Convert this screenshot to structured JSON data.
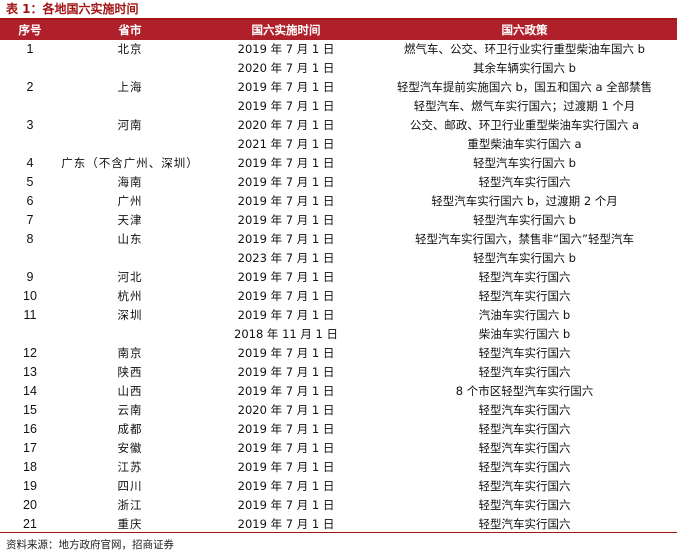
{
  "title": "表 1：各地国六实施时间",
  "headers": [
    "序号",
    "省市",
    "国六实施时间",
    "国六政策"
  ],
  "rows": [
    {
      "no": "1",
      "region": "北京",
      "date": "2019 年 7 月 1 日",
      "policy": "燃气车、公交、环卫行业实行重型柴油车国六 b"
    },
    {
      "no": "",
      "region": "",
      "date": "2020 年 7 月 1 日",
      "policy": "其余车辆实行国六 b"
    },
    {
      "no": "2",
      "region": "上海",
      "date": "2019 年 7 月 1 日",
      "policy": "轻型汽车提前实施国六 b，国五和国六 a 全部禁售"
    },
    {
      "no": "",
      "region": "",
      "date": "2019 年 7 月 1 日",
      "policy": "轻型汽车、燃气车实行国六；过渡期 1 个月"
    },
    {
      "no": "3",
      "region": "河南",
      "date": "2020 年 7 月 1 日",
      "policy": "公交、邮政、环卫行业重型柴油车实行国六 a"
    },
    {
      "no": "",
      "region": "",
      "date": "2021 年 7 月 1 日",
      "policy": "重型柴油车实行国六 a"
    },
    {
      "no": "4",
      "region": "广东（不含广州、深圳）",
      "date": "2019 年 7 月 1 日",
      "policy": "轻型汽车实行国六 b"
    },
    {
      "no": "5",
      "region": "海南",
      "date": "2019 年 7 月 1 日",
      "policy": "轻型汽车实行国六"
    },
    {
      "no": "6",
      "region": "广州",
      "date": "2019 年 7 月 1 日",
      "policy": "轻型汽车实行国六 b，过渡期 2 个月"
    },
    {
      "no": "7",
      "region": "天津",
      "date": "2019 年 7 月 1 日",
      "policy": "轻型汽车实行国六 b"
    },
    {
      "no": "8",
      "region": "山东",
      "date": "2019 年 7 月 1 日",
      "policy": "轻型汽车实行国六，禁售非“国六”轻型汽车"
    },
    {
      "no": "",
      "region": "",
      "date": "2023 年 7 月 1 日",
      "policy": "轻型汽车实行国六 b"
    },
    {
      "no": "9",
      "region": "河北",
      "date": "2019 年 7 月 1 日",
      "policy": "轻型汽车实行国六"
    },
    {
      "no": "10",
      "region": "杭州",
      "date": "2019 年 7 月 1 日",
      "policy": "轻型汽车实行国六"
    },
    {
      "no": "11",
      "region": "深圳",
      "date": "2019 年 7 月 1 日",
      "policy": "汽油车实行国六 b"
    },
    {
      "no": "",
      "region": "",
      "date": "2018 年 11 月 1 日",
      "policy": "柴油车实行国六 b"
    },
    {
      "no": "12",
      "region": "南京",
      "date": "2019 年 7 月 1 日",
      "policy": "轻型汽车实行国六"
    },
    {
      "no": "13",
      "region": "陕西",
      "date": "2019 年 7 月 1 日",
      "policy": "轻型汽车实行国六"
    },
    {
      "no": "14",
      "region": "山西",
      "date": "2019 年 7 月 1 日",
      "policy": "8 个市区轻型汽车实行国六"
    },
    {
      "no": "15",
      "region": "云南",
      "date": "2020 年 7 月 1 日",
      "policy": "轻型汽车实行国六"
    },
    {
      "no": "16",
      "region": "成都",
      "date": "2019 年 7 月 1 日",
      "policy": "轻型汽车实行国六"
    },
    {
      "no": "17",
      "region": "安徽",
      "date": "2019 年 7 月 1 日",
      "policy": "轻型汽车实行国六"
    },
    {
      "no": "18",
      "region": "江苏",
      "date": "2019 年 7 月 1 日",
      "policy": "轻型汽车实行国六"
    },
    {
      "no": "19",
      "region": "四川",
      "date": "2019 年 7 月 1 日",
      "policy": "轻型汽车实行国六"
    },
    {
      "no": "20",
      "region": "浙江",
      "date": "2019 年 7 月 1 日",
      "policy": "轻型汽车实行国六"
    },
    {
      "no": "21",
      "region": "重庆",
      "date": "2019 年 7 月 1 日",
      "policy": "轻型汽车实行国六"
    }
  ],
  "source": "资料来源：地方政府官网，招商证券"
}
